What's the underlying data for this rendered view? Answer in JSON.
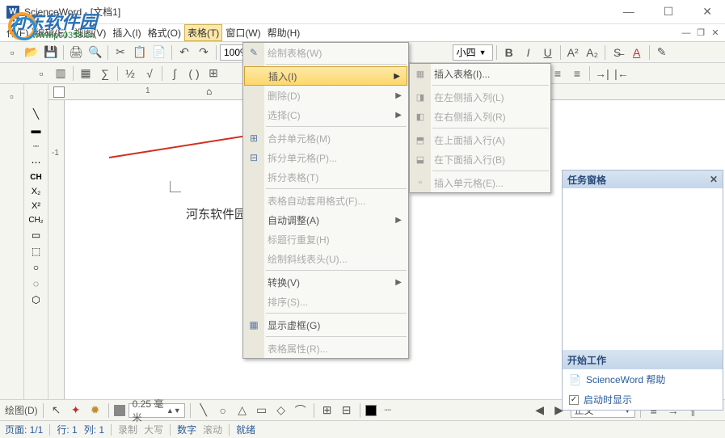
{
  "title": "ScienceWord  - [文档1]",
  "watermark": {
    "text": "河东软件园",
    "url": "www.pc0359.cn"
  },
  "menubar": {
    "file": "件(F)",
    "edit": "编辑(E)",
    "view": "视图(V)",
    "insert": "插入(I)",
    "format": "格式(O)",
    "table": "表格(T)",
    "window": "窗口(W)",
    "help": "帮助(H)"
  },
  "toolbar": {
    "zoom": "100%",
    "font_size": "小四"
  },
  "dropdown": {
    "draw_table": "绘制表格(W)",
    "insert": "插入(I)",
    "delete": "删除(D)",
    "select": "选择(C)",
    "merge_cells": "合并单元格(M)",
    "split_cells": "拆分单元格(P)...",
    "split_table": "拆分表格(T)",
    "autoformat": "表格自动套用格式(F)...",
    "autofit": "自动调整(A)",
    "heading_repeat": "标题行重复(H)",
    "draw_diagonal": "绘制斜线表头(U)...",
    "convert": "转换(V)",
    "sort": "排序(S)...",
    "show_gridlines": "显示虚框(G)",
    "table_properties": "表格属性(R)..."
  },
  "submenu": {
    "insert_table": "插入表格(I)...",
    "cols_left": "在左侧插入列(L)",
    "cols_right": "在右侧插入列(R)",
    "rows_above": "在上面插入行(A)",
    "rows_below": "在下面插入行(B)",
    "cells": "插入单元格(E)..."
  },
  "taskpane": {
    "title": "任务窗格",
    "section": "开始工作",
    "help_link": "ScienceWord 帮助",
    "show_startup": "启动时显示"
  },
  "page_text": "河东软件园",
  "bottombar": {
    "draw_label": "绘图(D)",
    "line_width": "0.25 毫米",
    "style_combo": "正文"
  },
  "status": {
    "page": "页面: 1/1",
    "line": "行: 1",
    "col": "列: 1",
    "rec": "录制",
    "caps": "大写",
    "num": "数字",
    "scroll": "滚动",
    "ready": "就绪"
  }
}
